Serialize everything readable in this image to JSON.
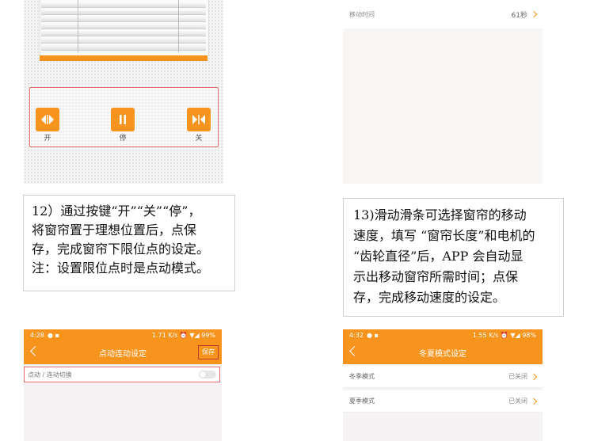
{
  "screen1": {
    "controls": {
      "open_label": "开",
      "stop_label": "停",
      "close_label": "关"
    }
  },
  "screen2": {
    "row_label": "移动时间",
    "row_value": "61秒"
  },
  "caption12": {
    "lines": [
      "12）通过按键“开”“关”“停”，",
      "将窗帘置于理想位置后，点保",
      "存，完成窗帘下限位点的设定。",
      "注：设置限位点时是点动模式。"
    ]
  },
  "caption13": {
    "lines": [
      "13)滑动滑条可选择窗帘的移动",
      "速度，填写 “窗帘长度”和电机的",
      "“齿轮直径”后，APP 会自动显",
      "示出移动窗帘所需时间；点保",
      "存，完成移动速度的设定。"
    ]
  },
  "screen3": {
    "status_time": "4:28",
    "status_right": "1.71 K/s ⏰ ▼◢ 99%",
    "title": "点动连动设定",
    "save_label": "保存",
    "toggle_row_label": "点动 / 连动切换",
    "toggle_on": false
  },
  "screen4": {
    "status_time": "4:32",
    "status_right": "1.55 K/s ⏰ ▼◢ 98%",
    "title": "冬夏模式设定",
    "rows": [
      {
        "label": "冬季模式",
        "value": "已关闭"
      },
      {
        "label": "夏季模式",
        "value": "已关闭"
      }
    ]
  },
  "colors": {
    "accent": "#f7941d",
    "highlight_border": "#e36b6b"
  }
}
